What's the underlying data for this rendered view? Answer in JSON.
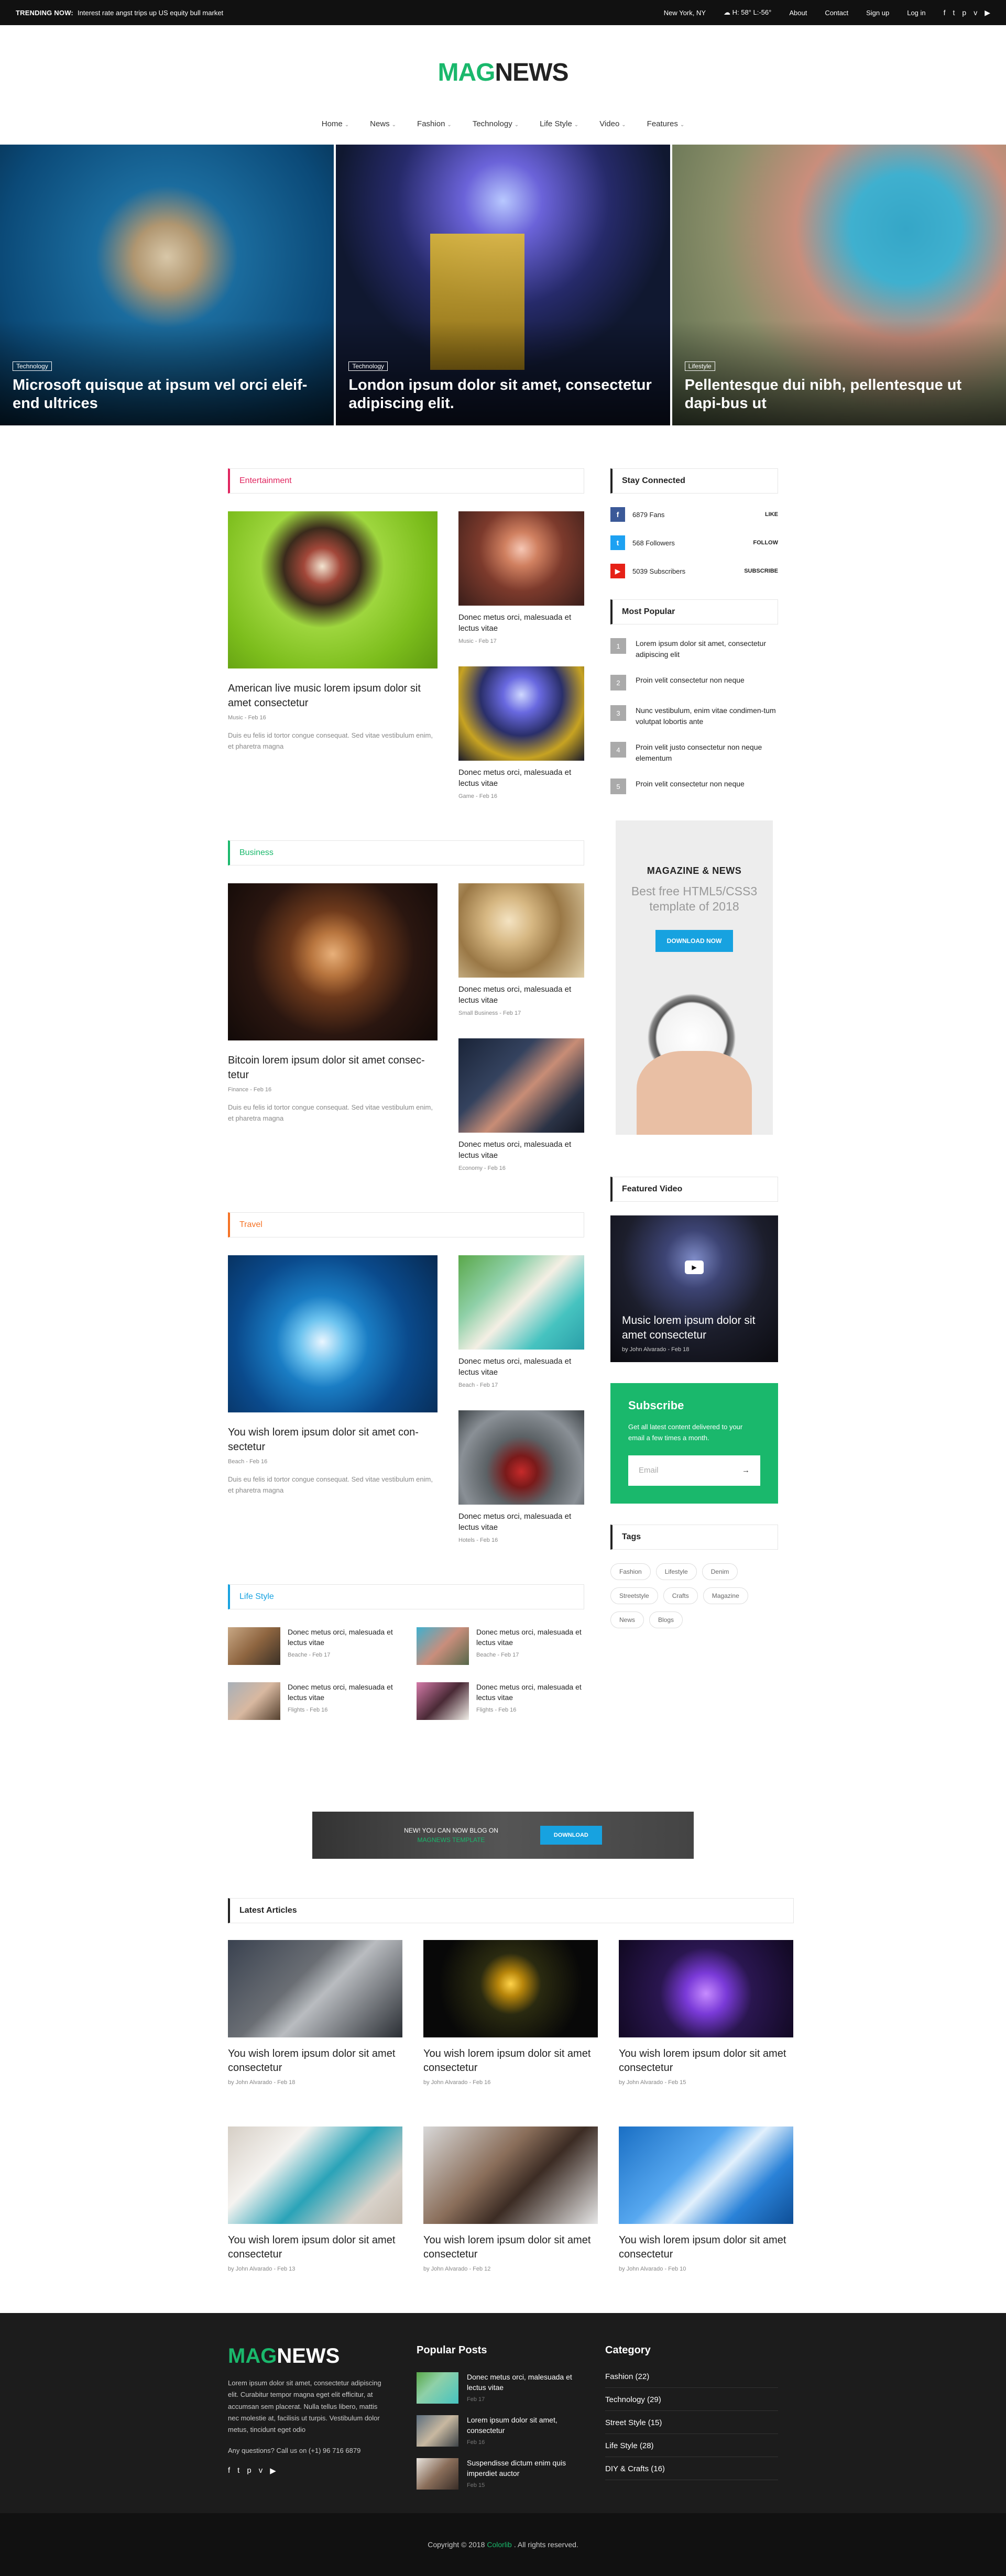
{
  "topbar": {
    "trending_label": "TRENDING NOW:",
    "trending_text": "Interest rate angst trips up US equity bull market",
    "weather": "New York, NY",
    "temp": "H: 58° L:-56°",
    "links": [
      "About",
      "Contact",
      "Sign up",
      "Log in"
    ]
  },
  "logo": {
    "mag": "MAG",
    "news": "NEWS"
  },
  "nav": [
    "Home",
    "News",
    "Fashion",
    "Technology",
    "Life Style",
    "Video",
    "Features"
  ],
  "hero": [
    {
      "tag": "Technology",
      "title": "Microsoft quisque at ipsum vel orci eleif-end ultrices"
    },
    {
      "tag": "Technology",
      "title": "London ipsum dolor sit amet, consectetur adipiscing elit."
    },
    {
      "tag": "Lifestyle",
      "title": "Pellentesque dui nibh, pellentesque ut dapi-bus ut"
    }
  ],
  "categories": [
    {
      "title": "Entertainment",
      "color": "#e0245e",
      "main": {
        "title": "American live music lorem ipsum dolor sit amet consectetur",
        "meta": "Music - Feb 16",
        "excerpt": "Duis eu felis id tortor congue consequat. Sed vitae vestibulum enim, et pharetra magna"
      },
      "smalls": [
        {
          "title": "Donec metus orci, malesuada et lectus vitae",
          "meta": "Music - Feb 17"
        },
        {
          "title": "Donec metus orci, malesuada et lectus vitae",
          "meta": "Game - Feb 16"
        }
      ]
    },
    {
      "title": "Business",
      "color": "#1ab86c",
      "main": {
        "title": "Bitcoin lorem ipsum dolor sit amet consec-tetur",
        "meta": "Finance - Feb 16",
        "excerpt": "Duis eu felis id tortor congue consequat. Sed vitae vestibulum enim, et pharetra magna"
      },
      "smalls": [
        {
          "title": "Donec metus orci, malesuada et lectus vitae",
          "meta": "Small Business - Feb 17"
        },
        {
          "title": "Donec metus orci, malesuada et lectus vitae",
          "meta": "Economy - Feb 16"
        }
      ]
    },
    {
      "title": "Travel",
      "color": "#f57224",
      "main": {
        "title": "You wish lorem ipsum dolor sit amet con-sectetur",
        "meta": "Beach - Feb 16",
        "excerpt": "Duis eu felis id tortor congue consequat. Sed vitae vestibulum enim, et pharetra magna"
      },
      "smalls": [
        {
          "title": "Donec metus orci, malesuada et lectus vitae",
          "meta": "Beach - Feb 17"
        },
        {
          "title": "Donec metus orci, malesuada et lectus vitae",
          "meta": "Hotels - Feb 16"
        }
      ]
    }
  ],
  "lifestyle": {
    "title": "Life Style",
    "items": [
      {
        "title": "Donec metus orci, malesuada et lectus vitae",
        "meta": "Beache - Feb 17"
      },
      {
        "title": "Donec metus orci, malesuada et lectus vitae",
        "meta": "Beache - Feb 17"
      },
      {
        "title": "Donec metus orci, malesuada et lectus vitae",
        "meta": "Flights - Feb 16"
      },
      {
        "title": "Donec metus orci, malesuada et lectus vitae",
        "meta": "Flights - Feb 16"
      }
    ]
  },
  "sidebar": {
    "stay_connected": "Stay Connected",
    "socials": [
      {
        "icon": "f",
        "count": "6879 Fans",
        "action": "LIKE",
        "color": "#3b5998"
      },
      {
        "icon": "t",
        "count": "568 Followers",
        "action": "FOLLOW",
        "color": "#1da1f2"
      },
      {
        "icon": "▶",
        "count": "5039 Subscribers",
        "action": "SUBSCRIBE",
        "color": "#e62117"
      }
    ],
    "most_popular": "Most Popular",
    "popular": [
      "Lorem ipsum dolor sit amet, consectetur adipiscing elit",
      "Proin velit consectetur non neque",
      "Nunc vestibulum, enim vitae condimen-tum volutpat lobortis ante",
      "Proin velit justo consectetur non neque elementum",
      "Proin velit consectetur non neque"
    ],
    "ad": {
      "heading": "MAGAZINE & NEWS",
      "sub": "Best free HTML5/CSS3 template of 2018",
      "button": "DOWNLOAD NOW"
    },
    "featured_video": "Featured Video",
    "video": {
      "title": "Music lorem ipsum dolor sit amet consectetur",
      "meta": "by John Alvarado - Feb 18"
    },
    "subscribe": {
      "title": "Subscribe",
      "desc": "Get all latest content delivered to your email a few times a month.",
      "placeholder": "Email"
    },
    "tags_title": "Tags",
    "tags": [
      "Fashion",
      "Lifestyle",
      "Denim",
      "Streetstyle",
      "Crafts",
      "Magazine",
      "News",
      "Blogs"
    ]
  },
  "banner": {
    "text1": "NEW! YOU CAN NOW BLOG ON",
    "text2": "MAGNEWS TEMPLATE",
    "button": "DOWNLOAD"
  },
  "latest": {
    "title": "Latest Articles",
    "items": [
      {
        "title": "You wish lorem ipsum dolor sit amet consectetur",
        "meta": "by John Alvarado - Feb 18"
      },
      {
        "title": "You wish lorem ipsum dolor sit amet consectetur",
        "meta": "by John Alvarado - Feb 16"
      },
      {
        "title": "You wish lorem ipsum dolor sit amet consectetur",
        "meta": "by John Alvarado - Feb 15"
      },
      {
        "title": "You wish lorem ipsum dolor sit amet consectetur",
        "meta": "by John Alvarado - Feb 13"
      },
      {
        "title": "You wish lorem ipsum dolor sit amet consectetur",
        "meta": "by John Alvarado - Feb 12"
      },
      {
        "title": "You wish lorem ipsum dolor sit amet consectetur",
        "meta": "by John Alvarado - Feb 10"
      }
    ]
  },
  "footer": {
    "about": "Lorem ipsum dolor sit amet, consectetur adipiscing elit. Curabitur tempor magna eget elit efficitur, at accumsan sem placerat. Nulla tellus libero, mattis nec molestie at, facilisis ut turpis. Vestibulum dolor metus, tincidunt eget odio",
    "call": "Any questions? Call us on (+1) 96 716 6879",
    "popular_title": "Popular Posts",
    "popular": [
      {
        "title": "Donec metus orci, malesuada et lectus vitae",
        "meta": "Feb 17"
      },
      {
        "title": "Lorem ipsum dolor sit amet, consectetur",
        "meta": "Feb 16"
      },
      {
        "title": "Suspendisse dictum enim quis imperdiet auctor",
        "meta": "Feb 15"
      }
    ],
    "category_title": "Category",
    "categories": [
      "Fashion (22)",
      "Technology (29)",
      "Street Style (15)",
      "Life Style (28)",
      "DIY & Crafts (16)"
    ],
    "copyright_pre": "Copyright © 2018",
    "copyright_brand": "Colorlib",
    "copyright_post": ". All rights reserved."
  }
}
